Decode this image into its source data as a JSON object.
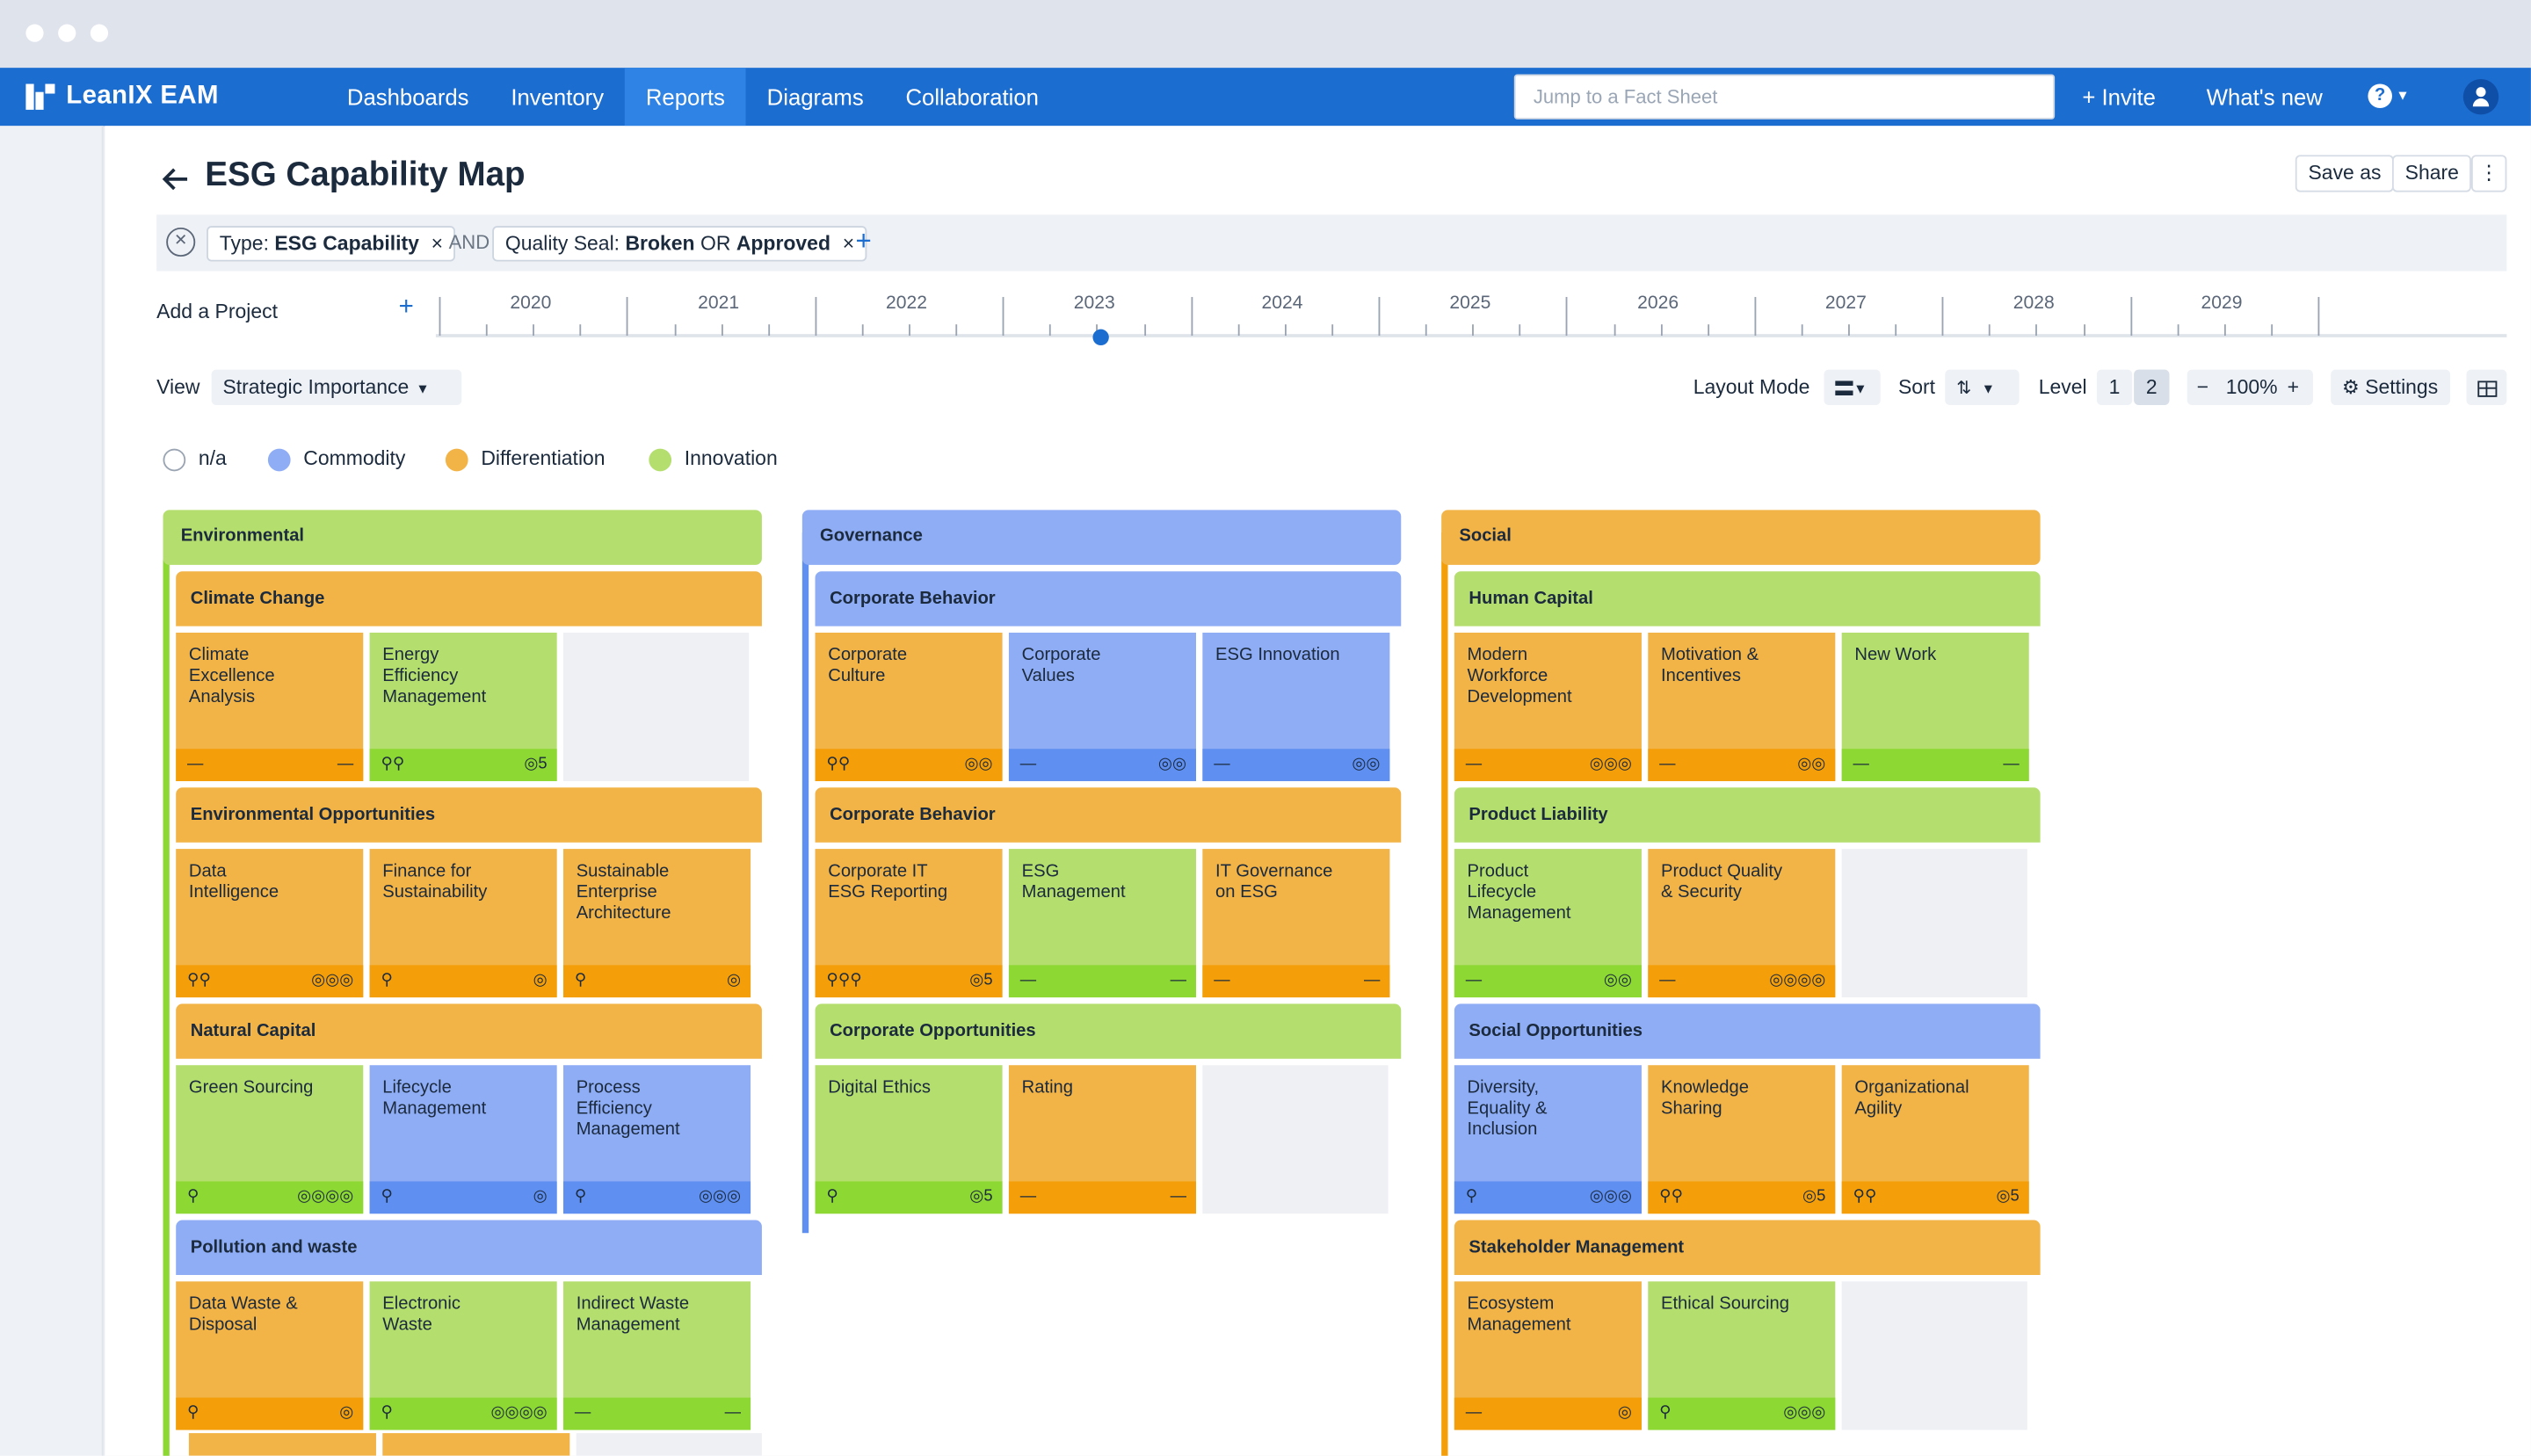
{
  "app": {
    "name": "LeanIX EAM"
  },
  "nav": {
    "items": [
      {
        "label": "Dashboards"
      },
      {
        "label": "Inventory"
      },
      {
        "label": "Reports"
      },
      {
        "label": "Diagrams"
      },
      {
        "label": "Collaboration"
      }
    ],
    "search_placeholder": "Jump to a Fact Sheet",
    "invite": "+ Invite",
    "whats_new": "What's new",
    "help": "?",
    "help_caret": "▾"
  },
  "page": {
    "title": "ESG Capability Map",
    "save_as": "Save as",
    "share": "Share",
    "more": "⋮"
  },
  "filters": {
    "clear": "✕",
    "type_label": "Type:",
    "type_value": "ESG Capability",
    "and": "AND",
    "seal_label": "Quality Seal:",
    "seal_v1": "Broken",
    "seal_or": "OR",
    "seal_v2": "Approved",
    "remove": "×",
    "add": "+"
  },
  "timeline": {
    "add_project": "Add a Project",
    "plus": "+",
    "years": [
      "2020",
      "2021",
      "2022",
      "2023",
      "2024",
      "2025",
      "2026",
      "2027",
      "2028",
      "2029"
    ],
    "current": "2023"
  },
  "controls": {
    "view_label": "View",
    "view_value": "Strategic Importance",
    "caret": "▾",
    "layout_label": "Layout Mode",
    "sort_label": "Sort",
    "level_label": "Level",
    "level1": "1",
    "level2": "2",
    "zoom_minus": "−",
    "zoom": "100%",
    "zoom_plus": "+",
    "settings": "Settings"
  },
  "legend": [
    {
      "label": "n/a",
      "color": "#ffffff"
    },
    {
      "label": "Commodity",
      "color": "#8fadf5"
    },
    {
      "label": "Differentiation",
      "color": "#f2b347"
    },
    {
      "label": "Innovation",
      "color": "#b4de6e"
    }
  ],
  "colors": {
    "orange": "#f2b347",
    "green": "#b4de6e",
    "blue": "#8fadf5",
    "nav": "#1c6dd0"
  },
  "map": {
    "environmental": {
      "title": "Environmental",
      "climate": {
        "title": "Climate Change",
        "c1": {
          "name": "Climate\nExcellence\nAnalysis",
          "l": "—",
          "r": "—"
        },
        "c2": {
          "name": "Energy\nEfficiency\nManagement",
          "l": "⚲⚲",
          "r": "◎5"
        }
      },
      "opps": {
        "title": "Environmental Opportunities",
        "c1": {
          "name": "Data\nIntelligence",
          "l": "⚲⚲",
          "r": "◎◎◎"
        },
        "c2": {
          "name": "Finance for\nSustainability",
          "l": "⚲",
          "r": "◎"
        },
        "c3": {
          "name": "Sustainable\nEnterprise\nArchitecture",
          "l": "⚲",
          "r": "◎"
        }
      },
      "natural": {
        "title": "Natural Capital",
        "c1": {
          "name": "Green Sourcing",
          "l": "⚲",
          "r": "◎◎◎◎"
        },
        "c2": {
          "name": "Lifecycle\nManagement",
          "l": "⚲",
          "r": "◎"
        },
        "c3": {
          "name": "Process\nEfficiency\nManagement",
          "l": "⚲",
          "r": "◎◎◎"
        }
      },
      "pollution": {
        "title": "Pollution and waste",
        "c1": {
          "name": "Data Waste &\nDisposal",
          "l": "⚲",
          "r": "◎"
        },
        "c2": {
          "name": "Electronic\nWaste",
          "l": "⚲",
          "r": "◎◎◎◎"
        },
        "c3": {
          "name": "Indirect Waste\nManagement",
          "l": "—",
          "r": "—"
        }
      }
    },
    "governance": {
      "title": "Governance",
      "behavior1": {
        "title": "Corporate Behavior",
        "c1": {
          "name": "Corporate\nCulture",
          "l": "⚲⚲",
          "r": "◎◎"
        },
        "c2": {
          "name": "Corporate\nValues",
          "l": "—",
          "r": "◎◎"
        },
        "c3": {
          "name": "ESG Innovation",
          "l": "—",
          "r": "◎◎"
        }
      },
      "behavior2": {
        "title": "Corporate Behavior",
        "c1": {
          "name": "Corporate IT\nESG Reporting",
          "l": "⚲⚲⚲",
          "r": "◎5"
        },
        "c2": {
          "name": "ESG\nManagement",
          "l": "—",
          "r": "—"
        },
        "c3": {
          "name": "IT Governance\non ESG",
          "l": "—",
          "r": "—"
        }
      },
      "opps": {
        "title": "Corporate Opportunities",
        "c1": {
          "name": "Digital Ethics",
          "l": "⚲",
          "r": "◎5"
        },
        "c2": {
          "name": "Rating",
          "l": "—",
          "r": "—"
        }
      }
    },
    "social": {
      "title": "Social",
      "human": {
        "title": "Human Capital",
        "c1": {
          "name": "Modern\nWorkforce\nDevelopment",
          "l": "—",
          "r": "◎◎◎"
        },
        "c2": {
          "name": "Motivation &\nIncentives",
          "l": "—",
          "r": "◎◎"
        },
        "c3": {
          "name": "New Work",
          "l": "—",
          "r": "—"
        }
      },
      "liability": {
        "title": "Product Liability",
        "c1": {
          "name": "Product\nLifecycle\nManagement",
          "l": "—",
          "r": "◎◎"
        },
        "c2": {
          "name": "Product Quality\n& Security",
          "l": "—",
          "r": "◎◎◎◎"
        }
      },
      "opps": {
        "title": "Social Opportunities",
        "c1": {
          "name": "Diversity,\nEquality &\nInclusion",
          "l": "⚲",
          "r": "◎◎◎"
        },
        "c2": {
          "name": "Knowledge\nSharing",
          "l": "⚲⚲",
          "r": "◎5"
        },
        "c3": {
          "name": "Organizational\nAgility",
          "l": "⚲⚲",
          "r": "◎5"
        }
      },
      "stake": {
        "title": "Stakeholder Management",
        "c1": {
          "name": "Ecosystem\nManagement",
          "l": "—",
          "r": "◎"
        },
        "c2": {
          "name": "Ethical Sourcing",
          "l": "⚲",
          "r": "◎◎◎"
        }
      }
    }
  }
}
